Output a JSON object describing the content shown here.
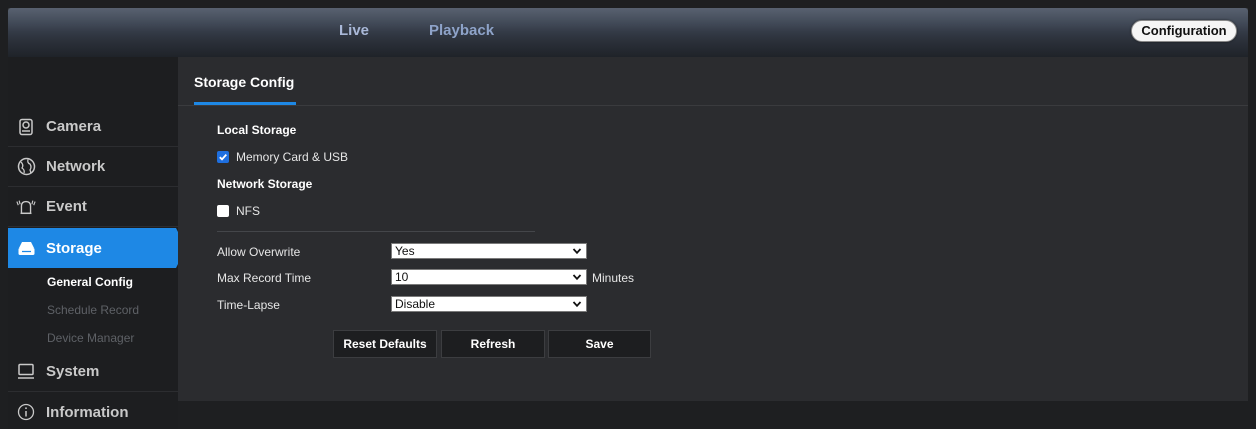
{
  "topnav": {
    "live": "Live",
    "playback": "Playback",
    "configuration": "Configuration"
  },
  "sidebar": {
    "items": [
      {
        "label": "Camera",
        "icon": "camera-icon"
      },
      {
        "label": "Network",
        "icon": "globe-icon"
      },
      {
        "label": "Event",
        "icon": "alarm-icon"
      },
      {
        "label": "Storage",
        "icon": "storage-icon",
        "active": true
      },
      {
        "label": "System",
        "icon": "monitor-icon"
      },
      {
        "label": "Information",
        "icon": "info-icon"
      }
    ],
    "storage_sub": [
      {
        "label": "General Config",
        "active": true
      },
      {
        "label": "Schedule Record"
      },
      {
        "label": "Device Manager"
      }
    ]
  },
  "main": {
    "tab_title": "Storage Config",
    "local_storage_label": "Local Storage",
    "memory_card_label": "Memory Card & USB",
    "memory_card_checked": true,
    "network_storage_label": "Network Storage",
    "nfs_label": "NFS",
    "nfs_checked": false,
    "allow_overwrite_label": "Allow Overwrite",
    "allow_overwrite_value": "Yes",
    "max_record_label": "Max Record Time",
    "max_record_value": "10",
    "max_record_unit": "Minutes",
    "time_lapse_label": "Time-Lapse",
    "time_lapse_value": "Disable",
    "buttons": {
      "reset": "Reset Defaults",
      "refresh": "Refresh",
      "save": "Save"
    }
  },
  "colors": {
    "accent": "#1e88e5",
    "background": "#1e1f21",
    "panel": "#2b2c2f"
  }
}
